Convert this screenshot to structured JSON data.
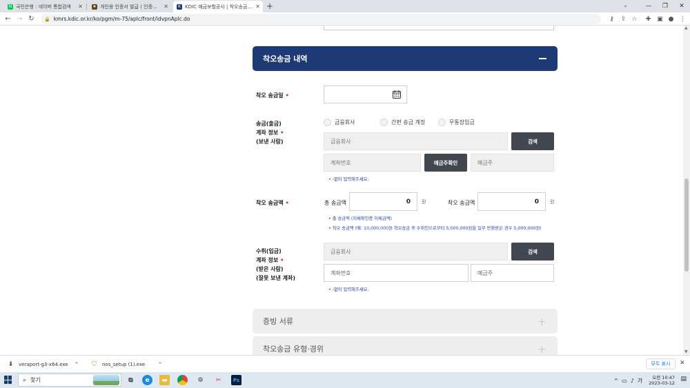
{
  "browser": {
    "tabs": [
      {
        "title": "국민은행 : 네이버 통합검색",
        "favicon": "naver-icon",
        "active": false
      },
      {
        "title": "개인용 인증서 발급 ( 인증센터) ",
        "favicon": "bank-icon",
        "active": false
      },
      {
        "title": "KDIC 예금보험공사 | 착오송금반환",
        "favicon": "kdic-icon",
        "active": true
      }
    ],
    "url": "kmrs.kdic.or.kr/ko/pgm/m-75/aplc/front/idvpnAplc.do"
  },
  "page": {
    "section_title": "착오송금 내역",
    "date_label": "착오 송금일",
    "sender": {
      "label_lines": [
        "송금(출금)",
        "계좌 정보",
        "(보낸 사람)"
      ],
      "radio_options": [
        "금융회사",
        "간편 송금 계정",
        "무통장입금"
      ],
      "institution_placeholder": "금융회사",
      "search_btn": "검색",
      "account_placeholder": "계좌번호",
      "verify_btn": "예금주확인",
      "holder_placeholder": "예금주",
      "note": "• -없이 입력해주세요."
    },
    "amount": {
      "label": "착오 송금액",
      "total_label": "총 송금액",
      "total_value": "0",
      "mistaken_label": "착오 송금액",
      "mistaken_value": "0",
      "unit": "원",
      "notes": [
        "• 총 송금액 (이체확인증 이체금액)",
        "• 착오 송금액 (예: 10,000,000원 착오송금 후 수취인으로부터 5,000,000원을 일부 반환받은 경우 5,000,000원)"
      ]
    },
    "receiver": {
      "label_lines": [
        "수취(입금)",
        "계좌 정보",
        "(받은 사람)",
        "(잘못 보낸 계좌)"
      ],
      "institution_placeholder": "금융회사",
      "search_btn": "검색",
      "account_placeholder": "계좌번호",
      "holder_placeholder": "예금주",
      "note": "• -없이 입력해주세요."
    },
    "collapsed_sections": [
      "증빙 서류",
      "착오송금 유형·경위"
    ]
  },
  "downloads": {
    "items": [
      "veraport-g3-x64.exe",
      "nos_setup (1).exe"
    ],
    "show_all": "모두 표시"
  },
  "taskbar": {
    "search_placeholder": "찾기",
    "time": "오전 10:47",
    "date": "2023-03-12"
  }
}
